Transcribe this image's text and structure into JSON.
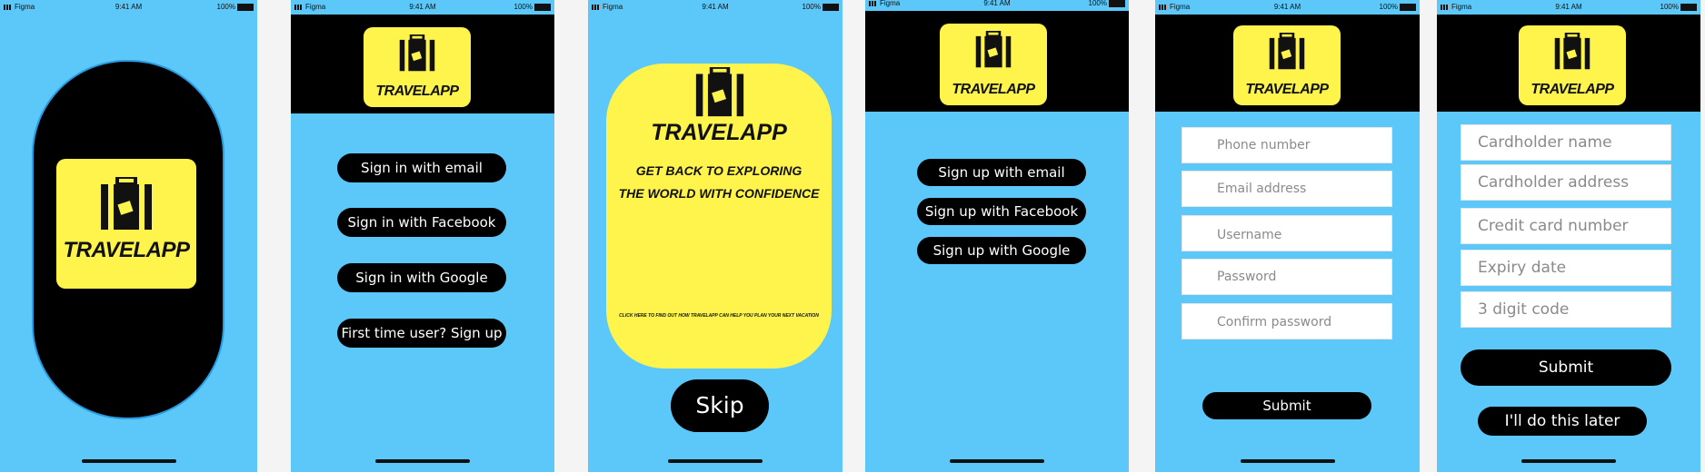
{
  "status_bar": {
    "carrier": "Figma",
    "time": "9:41 AM",
    "battery": "100%"
  },
  "brand": {
    "logo_text": "TRAVELAPP",
    "yellow": "#fff44b",
    "blue": "#5bc8f9",
    "black": "#000000"
  },
  "screen_signin": {
    "buttons": [
      "Sign in with email",
      "Sign in with Facebook",
      "Sign in with Google",
      "First time user? Sign up"
    ]
  },
  "screen_onboarding": {
    "headline_line1": "GET BACK TO EXPLORING",
    "headline_line2": "THE WORLD WITH CONFIDENCE",
    "link_text": "CLICK HERE TO FIND OUT HOW TRAVELAPP CAN HELP YOU PLAN YOUR NEXT VACATION",
    "skip_label": "Skip"
  },
  "screen_signup": {
    "buttons": [
      "Sign up with email",
      "Sign up with Facebook",
      "Sign up with Google"
    ]
  },
  "screen_register": {
    "placeholders": [
      "Phone number",
      "Email address",
      "Username",
      "Password",
      "Confirm password"
    ],
    "submit_label": "Submit"
  },
  "screen_payment": {
    "placeholders": [
      "Cardholder name",
      "Cardholder address",
      "Credit card number",
      "Expiry date",
      "3 digit code"
    ],
    "submit_label": "Submit",
    "later_label": "I'll do this later"
  }
}
